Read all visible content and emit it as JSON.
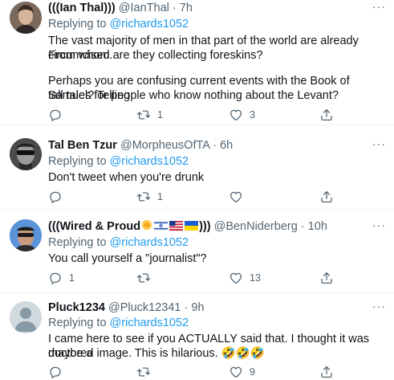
{
  "tweets": [
    {
      "name": "(((Ian Thal)))",
      "handle": "@IanThal",
      "dot": "·",
      "time": "7h",
      "replying_prefix": "Replying to",
      "replying_to": "@richards1052",
      "body_line1": "The vast majority of men in that part of the world are already circumcised.",
      "body_line2": "From whom are they collecting foreskins?",
      "body_line3": "Perhaps you are confusing current events with the Book of Samuel? Telling",
      "body_line4": "tall tales for people who know nothing about the Levant?",
      "replies": "",
      "retweets": "1",
      "likes": "3"
    },
    {
      "name": "Tal Ben Tzur",
      "handle": "@MorpheusOfTA",
      "dot": "·",
      "time": "6h",
      "replying_prefix": "Replying to",
      "replying_to": "@richards1052",
      "body_line1": "Don't tweet when you're drunk",
      "replies": "",
      "retweets": "1",
      "likes": ""
    },
    {
      "name": "(((Wired & Proud",
      "name_suffix": ")))",
      "handle": "@BenNiderberg",
      "dot": "·",
      "time": "10h",
      "replying_prefix": "Replying to",
      "replying_to": "@richards1052",
      "body_line1": "You call yourself a \"journalist\"?",
      "replies": "1",
      "retweets": "",
      "likes": "13"
    },
    {
      "name": "Pluck1234",
      "handle": "@Pluck12341",
      "dot": "·",
      "time": "9h",
      "replying_prefix": "Replying to",
      "replying_to": "@richards1052",
      "body_line1": "I came here to see if you ACTUALLY said that. I thought it was maybe a",
      "body_line2": "doctored image. This is hilarious. 🤣🤣🤣",
      "replies": "",
      "retweets": "",
      "likes": "9"
    }
  ],
  "more_label": "···",
  "colors": {
    "link": "#1d9bf0",
    "muted": "#536471",
    "text": "#0f1419",
    "divider": "#eff3f4"
  },
  "icons": [
    "reply-icon",
    "retweet-icon",
    "like-icon",
    "share-icon",
    "more-icon"
  ]
}
